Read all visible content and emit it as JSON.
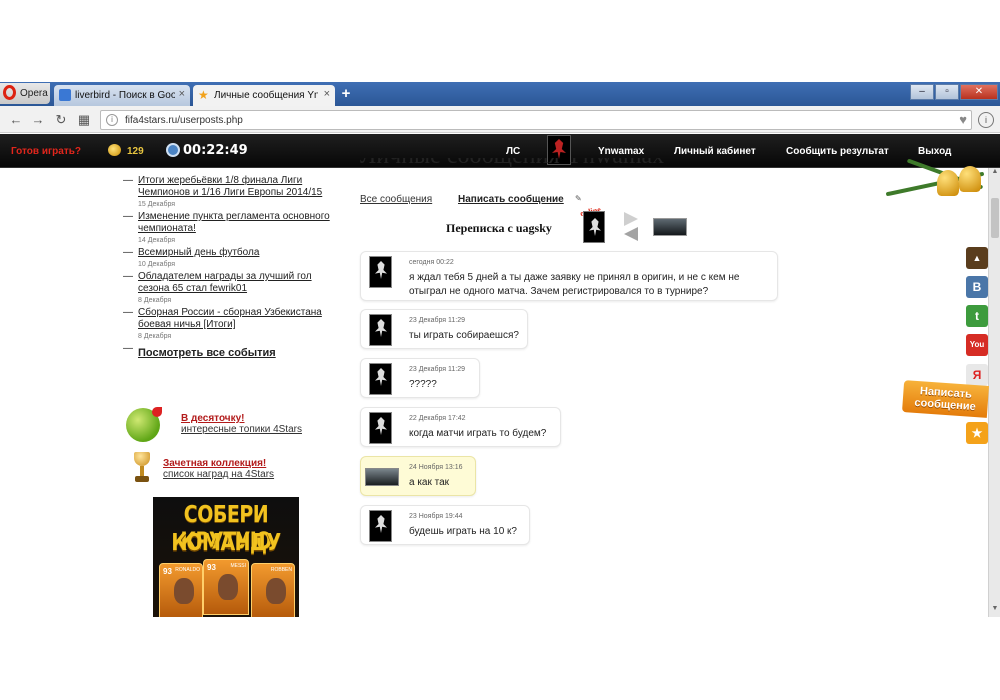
{
  "browser": {
    "menu_label": "Opera",
    "tabs": [
      {
        "title": "liverbird - Поиск в Google",
        "close": "×"
      },
      {
        "title": "Личные сообщения Ynwa",
        "close": "×"
      }
    ],
    "new_tab": "+",
    "url": "fifa4stars.ru/userposts.php"
  },
  "sitebar": {
    "ready": "Готов играть?",
    "coins": "129",
    "timer": "00:22:49",
    "nav": {
      "ls": "ЛС",
      "username": "Ynwamax",
      "cabinet": "Личный кабинет",
      "report": "Сообщить результат",
      "logout": "Выход"
    }
  },
  "events": [
    {
      "title": "Итоги жеребьёвки 1/8 финала Лиги Чемпионов и 1/16 Лиги Европы 2014/15",
      "date": "15 Декабря"
    },
    {
      "title": "Изменение пункта регламента основного чемпионата!",
      "date": "14 Декабря"
    },
    {
      "title": "Всемирный день футбола",
      "date": "10 Декабря"
    },
    {
      "title": "Обладателем награды за лучший гол сезона 65 стал fewrik01",
      "date": "8 Декабря"
    },
    {
      "title": "Сборная России - сборная Узбекистана боевая ничья [Итоги]",
      "date": "8 Декабря"
    }
  ],
  "all_events": "Посмотреть все события",
  "promos": [
    {
      "title": "В десяточку!",
      "subtitle": "интересные топики 4Stars"
    },
    {
      "title": "Зачетная коллекция!",
      "subtitle": "список наград на 4Stars"
    }
  ],
  "banner": {
    "line1": "СОБЕРИ КРУТУЮ",
    "line2": "КОМАНДУ",
    "cards": [
      {
        "rating": "93",
        "name": "RONALDO"
      },
      {
        "rating": "93",
        "name": "MESSI"
      },
      {
        "rating": "",
        "name": "ROBBEN"
      }
    ]
  },
  "messages_page": {
    "heading": "Личные сообщения Ynwamax",
    "tab_all": "Все сообщения",
    "tab_write": "Написать сообщение",
    "conversation_title": "Переписка с uagsky",
    "online": "online",
    "messages": [
      {
        "time": "сегодня 00:22",
        "text": "я ждал тебя 5 дней а ты даже заявку не принял в оригин, и не с кем не отыграл не одного матча. Зачем регистрировался то в турнире?",
        "mine": false
      },
      {
        "time": "23 Декабря 11:29",
        "text": "ты играть собираешся?",
        "mine": false
      },
      {
        "time": "23 Декабря 11:29",
        "text": "?????",
        "mine": false
      },
      {
        "time": "22 Декабря 17:42",
        "text": "когда матчи играть то будем?",
        "mine": false
      },
      {
        "time": "24 Ноября 13:16",
        "text": "а как так",
        "mine": true
      },
      {
        "time": "23 Ноября 19:44",
        "text": "будешь играть на 10 к?",
        "mine": false
      }
    ]
  },
  "social": [
    {
      "name": "vk",
      "glyph": "B",
      "color": "#4a76a8"
    },
    {
      "name": "twitter",
      "glyph": "t",
      "color": "#3d9b3d"
    },
    {
      "name": "youtube",
      "glyph": "You",
      "color": "#d62c24"
    },
    {
      "name": "yandex",
      "glyph": "Я",
      "color": "#e8e8e8"
    },
    {
      "name": "star",
      "glyph": "★",
      "color": "#f4a21a"
    }
  ],
  "write_tab": "Написать сообщение"
}
